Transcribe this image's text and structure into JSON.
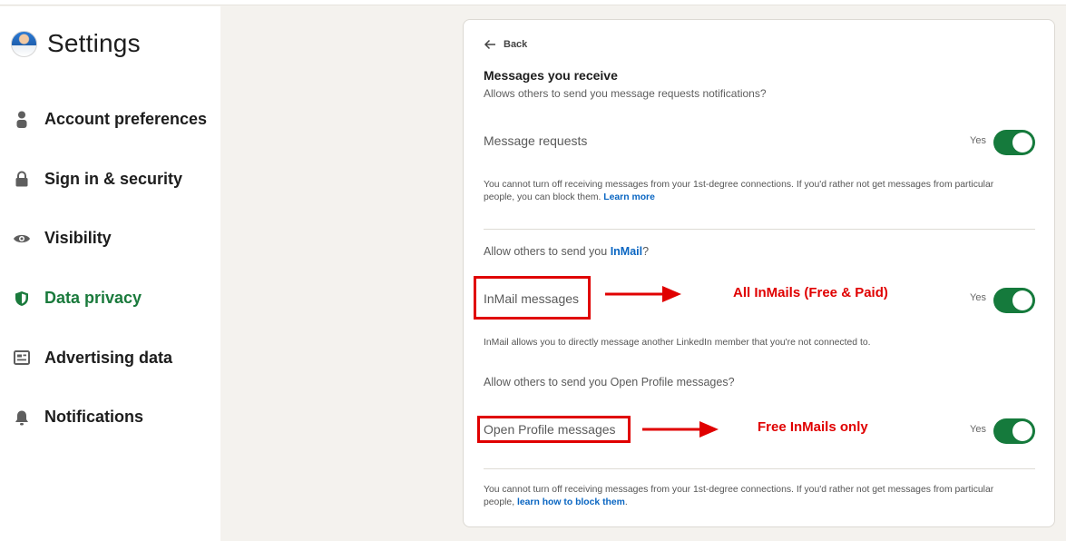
{
  "sidebar": {
    "title": "Settings",
    "items": [
      {
        "label": "Account preferences",
        "icon": "person-icon"
      },
      {
        "label": "Sign in & security",
        "icon": "lock-icon"
      },
      {
        "label": "Visibility",
        "icon": "eye-icon"
      },
      {
        "label": "Data privacy",
        "icon": "shield-icon"
      },
      {
        "label": "Advertising data",
        "icon": "newspaper-icon"
      },
      {
        "label": "Notifications",
        "icon": "bell-icon"
      }
    ],
    "active": "Data privacy"
  },
  "panel": {
    "back_label": "Back",
    "section_title": "Messages you receive",
    "section_subtitle": "Allows others to send you message requests notifications?",
    "message_requests": {
      "label": "Message requests",
      "value": "Yes",
      "on": true
    },
    "note1": {
      "text": "You cannot turn off receiving messages from your 1st-degree connections. If you'd rather not get messages from particular people, you can block them.",
      "link": "Learn more"
    },
    "inmail_question": {
      "prefix": "Allow others to send you",
      "link": "InMail",
      "suffix": "?"
    },
    "inmail_messages": {
      "label": "InMail messages",
      "value": "Yes",
      "on": true
    },
    "inmail_note": "InMail allows you to directly message another LinkedIn member that you're not connected to.",
    "open_profile_question": "Allow others to send you Open Profile messages?",
    "open_profile_messages": {
      "label": "Open Profile messages",
      "value": "Yes",
      "on": true
    },
    "note2": {
      "text": "You cannot turn off receiving messages from your 1st-degree connections. If you'd rather not get messages from particular people,",
      "link": "learn how to block them",
      "suffix": "."
    }
  },
  "annotations": {
    "inmail": "All InMails (Free & Paid)",
    "open_profile": "Free InMails only",
    "color": "#e00000"
  },
  "colors": {
    "accent_green": "#157a3c",
    "link_blue": "#0a66c2",
    "page_bg": "#f4f2ee"
  }
}
